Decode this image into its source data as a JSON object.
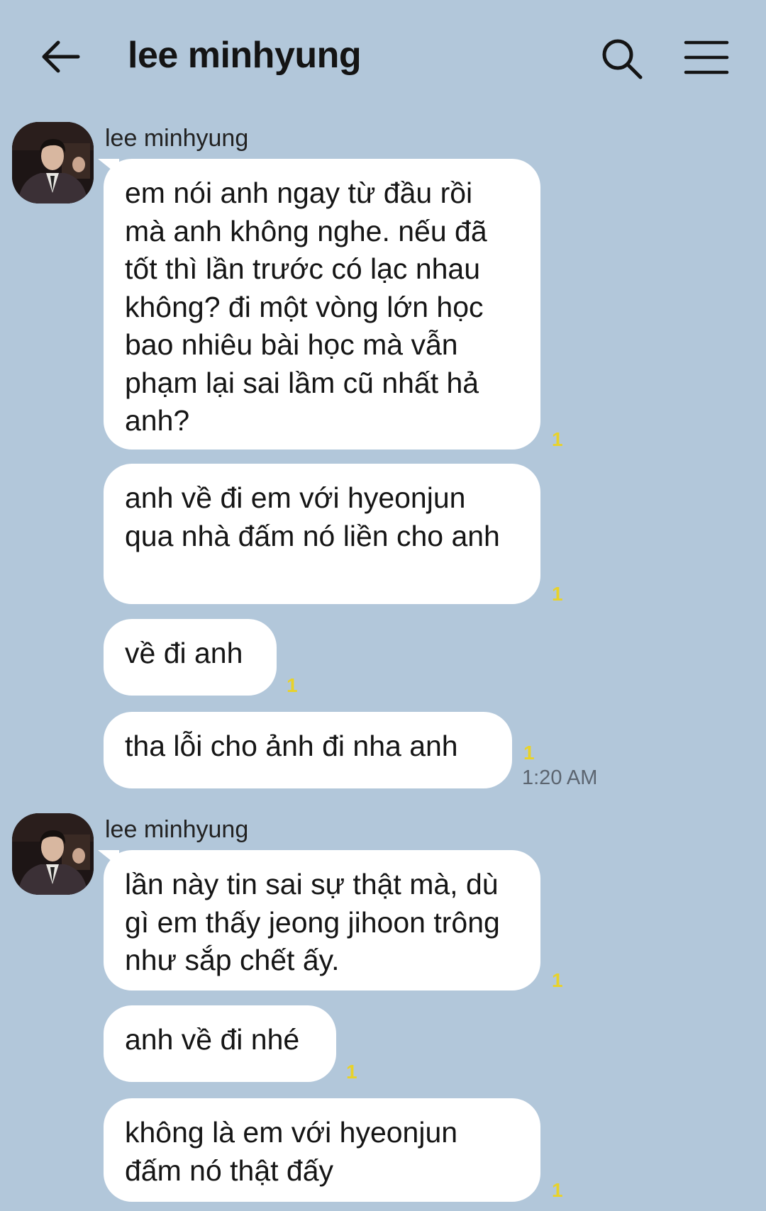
{
  "header": {
    "title": "lee minhyung",
    "back_icon": "arrow-left-icon",
    "search_icon": "search-icon",
    "menu_icon": "hamburger-menu-icon"
  },
  "colors": {
    "background": "#b2c7da",
    "bubble": "#ffffff",
    "unread_count": "#e8d22a"
  },
  "groups": [
    {
      "sender": "lee minhyung",
      "messages": [
        {
          "text": "em nói anh ngay từ đầu rồi mà anh không nghe. nếu đã tốt thì lần trước có lạc nhau không? đi một vòng lớn học bao nhiêu bài học mà vẫn phạm lại sai lầm cũ nhất hả anh?",
          "unread": "1",
          "time": ""
        },
        {
          "text": "anh về đi em với hyeonjun qua nhà đấm nó liền cho anh",
          "unread": "1",
          "time": ""
        },
        {
          "text": "về đi anh",
          "unread": "1",
          "time": ""
        },
        {
          "text": "tha lỗi cho ảnh đi nha anh",
          "unread": "1",
          "time": "1:20 AM"
        }
      ]
    },
    {
      "sender": "lee minhyung",
      "messages": [
        {
          "text": "lần này tin sai sự thật mà, dù gì em thấy jeong jihoon trông như sắp chết ấy.",
          "unread": "1",
          "time": ""
        },
        {
          "text": "anh về đi nhé",
          "unread": "1",
          "time": ""
        },
        {
          "text": "không là em với hyeonjun đấm nó thật đấy",
          "unread": "1",
          "time": ""
        }
      ]
    }
  ]
}
